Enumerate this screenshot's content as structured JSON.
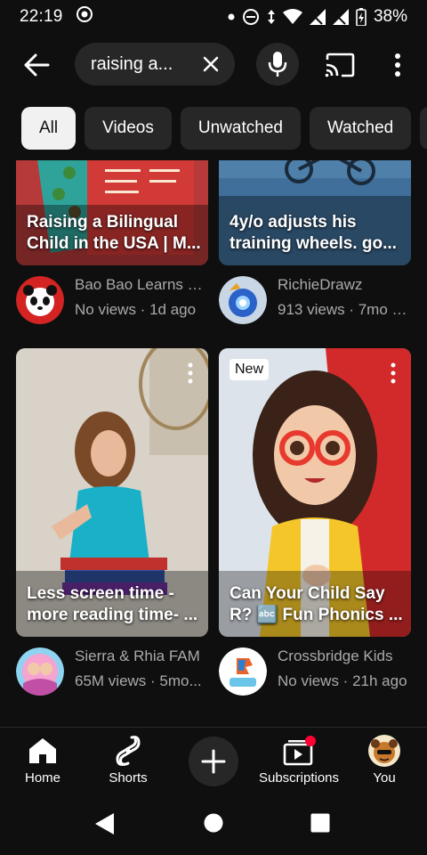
{
  "status_bar": {
    "time": "22:19",
    "battery": "38%"
  },
  "search": {
    "query": "raising a..."
  },
  "chips": [
    {
      "label": "All",
      "active": true
    },
    {
      "label": "Videos",
      "active": false
    },
    {
      "label": "Unwatched",
      "active": false
    },
    {
      "label": "Watched",
      "active": false
    }
  ],
  "videos": [
    {
      "title_line1": "Raising a Bilingual",
      "title_line2": "Child in the USA | M...",
      "channel": "Bao Bao Learns C...",
      "stats": "No views · 1d ago"
    },
    {
      "title_line1": "4y/o adjusts his",
      "title_line2": "training wheels. go...",
      "channel": "RichieDrawz",
      "stats": "913 views · 7mo a..."
    },
    {
      "title_line1": "Less screen time -",
      "title_line2": "more reading time- ...",
      "channel": "Sierra & Rhia FAM",
      "stats": "65M views · 5mo..."
    },
    {
      "badge": "New",
      "title_line1": "Can Your Child Say",
      "title_line2": "R? 🔤 Fun Phonics ...",
      "channel": "Crossbridge Kids",
      "stats": "No views · 21h ago"
    }
  ],
  "bottom_nav": {
    "home": "Home",
    "shorts": "Shorts",
    "subscriptions": "Subscriptions",
    "you": "You"
  },
  "colors": {
    "background": "#0f0f0f",
    "chip_bg": "#272727",
    "chip_active_bg": "#f1f1f1",
    "secondary_text": "#aaaaaa",
    "notification_dot": "#ff0033"
  }
}
